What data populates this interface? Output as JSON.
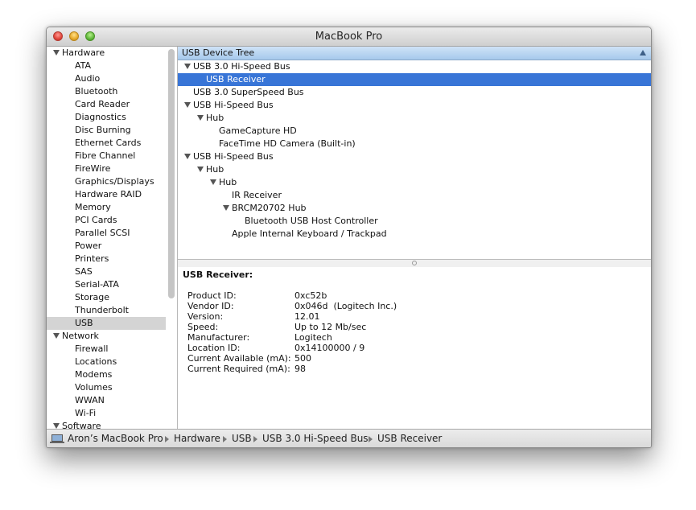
{
  "window": {
    "title": "MacBook Pro"
  },
  "sidebar": {
    "rows": [
      {
        "label": "Hardware",
        "type": "category"
      },
      {
        "label": "ATA",
        "type": "item"
      },
      {
        "label": "Audio",
        "type": "item"
      },
      {
        "label": "Bluetooth",
        "type": "item"
      },
      {
        "label": "Card Reader",
        "type": "item"
      },
      {
        "label": "Diagnostics",
        "type": "item"
      },
      {
        "label": "Disc Burning",
        "type": "item"
      },
      {
        "label": "Ethernet Cards",
        "type": "item"
      },
      {
        "label": "Fibre Channel",
        "type": "item"
      },
      {
        "label": "FireWire",
        "type": "item"
      },
      {
        "label": "Graphics/Displays",
        "type": "item"
      },
      {
        "label": "Hardware RAID",
        "type": "item"
      },
      {
        "label": "Memory",
        "type": "item"
      },
      {
        "label": "PCI Cards",
        "type": "item"
      },
      {
        "label": "Parallel SCSI",
        "type": "item"
      },
      {
        "label": "Power",
        "type": "item"
      },
      {
        "label": "Printers",
        "type": "item"
      },
      {
        "label": "SAS",
        "type": "item"
      },
      {
        "label": "Serial-ATA",
        "type": "item"
      },
      {
        "label": "Storage",
        "type": "item"
      },
      {
        "label": "Thunderbolt",
        "type": "item"
      },
      {
        "label": "USB",
        "type": "item",
        "selected": true
      },
      {
        "label": "Network",
        "type": "category"
      },
      {
        "label": "Firewall",
        "type": "item"
      },
      {
        "label": "Locations",
        "type": "item"
      },
      {
        "label": "Modems",
        "type": "item"
      },
      {
        "label": "Volumes",
        "type": "item"
      },
      {
        "label": "WWAN",
        "type": "item"
      },
      {
        "label": "Wi-Fi",
        "type": "item"
      },
      {
        "label": "Software",
        "type": "category"
      }
    ]
  },
  "tree": {
    "header": "USB Device Tree",
    "rows": [
      {
        "label": "USB 3.0 Hi-Speed Bus",
        "level": 0,
        "expanded": true
      },
      {
        "label": "USB Receiver",
        "level": 1,
        "selected": true
      },
      {
        "label": "USB 3.0 SuperSpeed Bus",
        "level": 0
      },
      {
        "label": "USB Hi-Speed Bus",
        "level": 0,
        "expanded": true
      },
      {
        "label": "Hub",
        "level": 1,
        "expanded": true
      },
      {
        "label": "GameCapture HD",
        "level": 2
      },
      {
        "label": "FaceTime HD Camera (Built-in)",
        "level": 2
      },
      {
        "label": "USB Hi-Speed Bus",
        "level": 0,
        "expanded": true
      },
      {
        "label": "Hub",
        "level": 1,
        "expanded": true
      },
      {
        "label": "Hub",
        "level": 2,
        "expanded": true
      },
      {
        "label": "IR Receiver",
        "level": 3
      },
      {
        "label": "BRCM20702 Hub",
        "level": 3,
        "expanded": true
      },
      {
        "label": "Bluetooth USB Host Controller",
        "level": 4
      },
      {
        "label": "Apple Internal Keyboard / Trackpad",
        "level": 3
      }
    ]
  },
  "details": {
    "title": "USB Receiver:",
    "fields": [
      {
        "key": "Product ID:",
        "value": "0xc52b"
      },
      {
        "key": "Vendor ID:",
        "value": "0x046d  (Logitech Inc.)"
      },
      {
        "key": "Version:",
        "value": "12.01"
      },
      {
        "key": "Speed:",
        "value": "Up to 12 Mb/sec"
      },
      {
        "key": "Manufacturer:",
        "value": "Logitech"
      },
      {
        "key": "Location ID:",
        "value": "0x14100000 / 9"
      },
      {
        "key": "Current Available (mA):",
        "value": "500"
      },
      {
        "key": "Current Required (mA):",
        "value": "98"
      }
    ]
  },
  "pathbar": {
    "crumbs": [
      "Aron’s MacBook Pro",
      "Hardware",
      "USB",
      "USB 3.0 Hi-Speed Bus",
      "USB Receiver"
    ],
    "icon": "laptop-icon"
  },
  "colors": {
    "selection": "#3875d7",
    "sidebar_selection": "#d4d4d4",
    "header": "#b8d4f0"
  }
}
